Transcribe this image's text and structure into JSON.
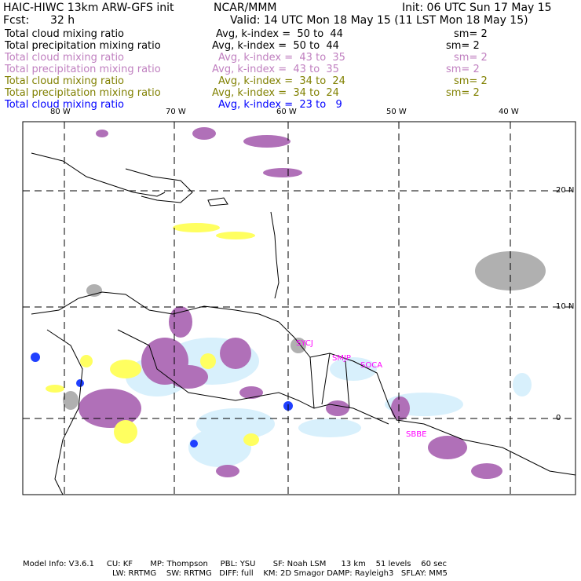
{
  "header": {
    "title": "HAIC-HIWC 13km ARW-GFS init",
    "org": "NCAR/MMM",
    "init": "Init: 06 UTC Sun 17 May 15",
    "fcst_label": "Fcst:",
    "fcst_value": "32 h",
    "valid": "Valid: 14 UTC Mon 18 May 15 (11 LST Mon 18 May 15)"
  },
  "legend": [
    {
      "field": "Total cloud mixing ratio",
      "range": "Avg, k-index =  50 to  44",
      "sm": "sm= 2",
      "color": "#000000"
    },
    {
      "field": "Total precipitation mixing ratio",
      "range": "Avg, k-index =  50 to  44",
      "sm": "sm= 2",
      "color": "#000000"
    },
    {
      "field": "Total cloud mixing ratio",
      "range": "Avg, k-index =  43 to  35",
      "sm": "sm= 2",
      "color": "#c080c0"
    },
    {
      "field": "Total precipitation mixing ratio",
      "range": "Avg, k-index =  43 to  35",
      "sm": "sm= 2",
      "color": "#c080c0"
    },
    {
      "field": "Total cloud mixing ratio",
      "range": "Avg, k-index =  34 to  24",
      "sm": "sm= 2",
      "color": "#808000"
    },
    {
      "field": "Total precipitation mixing ratio",
      "range": "Avg, k-index =  34 to  24",
      "sm": "sm= 2",
      "color": "#808000"
    },
    {
      "field": "Total cloud mixing ratio",
      "range": "Avg, k-index =  23 to   9",
      "sm": "",
      "color": "#0000ff"
    }
  ],
  "axes": {
    "lon_labels": [
      "80 W",
      "70 W",
      "60 W",
      "50 W",
      "40 W"
    ],
    "lat_labels": [
      "20 N",
      "10 N",
      "0"
    ]
  },
  "stations": [
    "SYCJ",
    "SMJP",
    "SOCA",
    "SBBE"
  ],
  "footer": {
    "line1": "Model Info: V3.6.1     CU: KF       MP: Thompson     PBL: YSU       SF: Noah LSM      13 km    51 levels    60 sec",
    "line2": "LW: RRTMG    SW: RRTMG   DIFF: full    KM: 2D Smagor DAMP: Rayleigh3   SFLAY: MM5"
  },
  "colors": {
    "purple": "#b070b8",
    "yellow": "#ffff60",
    "gray": "#b0b0b0",
    "lightblue": "#d8f0fc",
    "blue": "#2040ff",
    "station": "#ff00ff"
  }
}
